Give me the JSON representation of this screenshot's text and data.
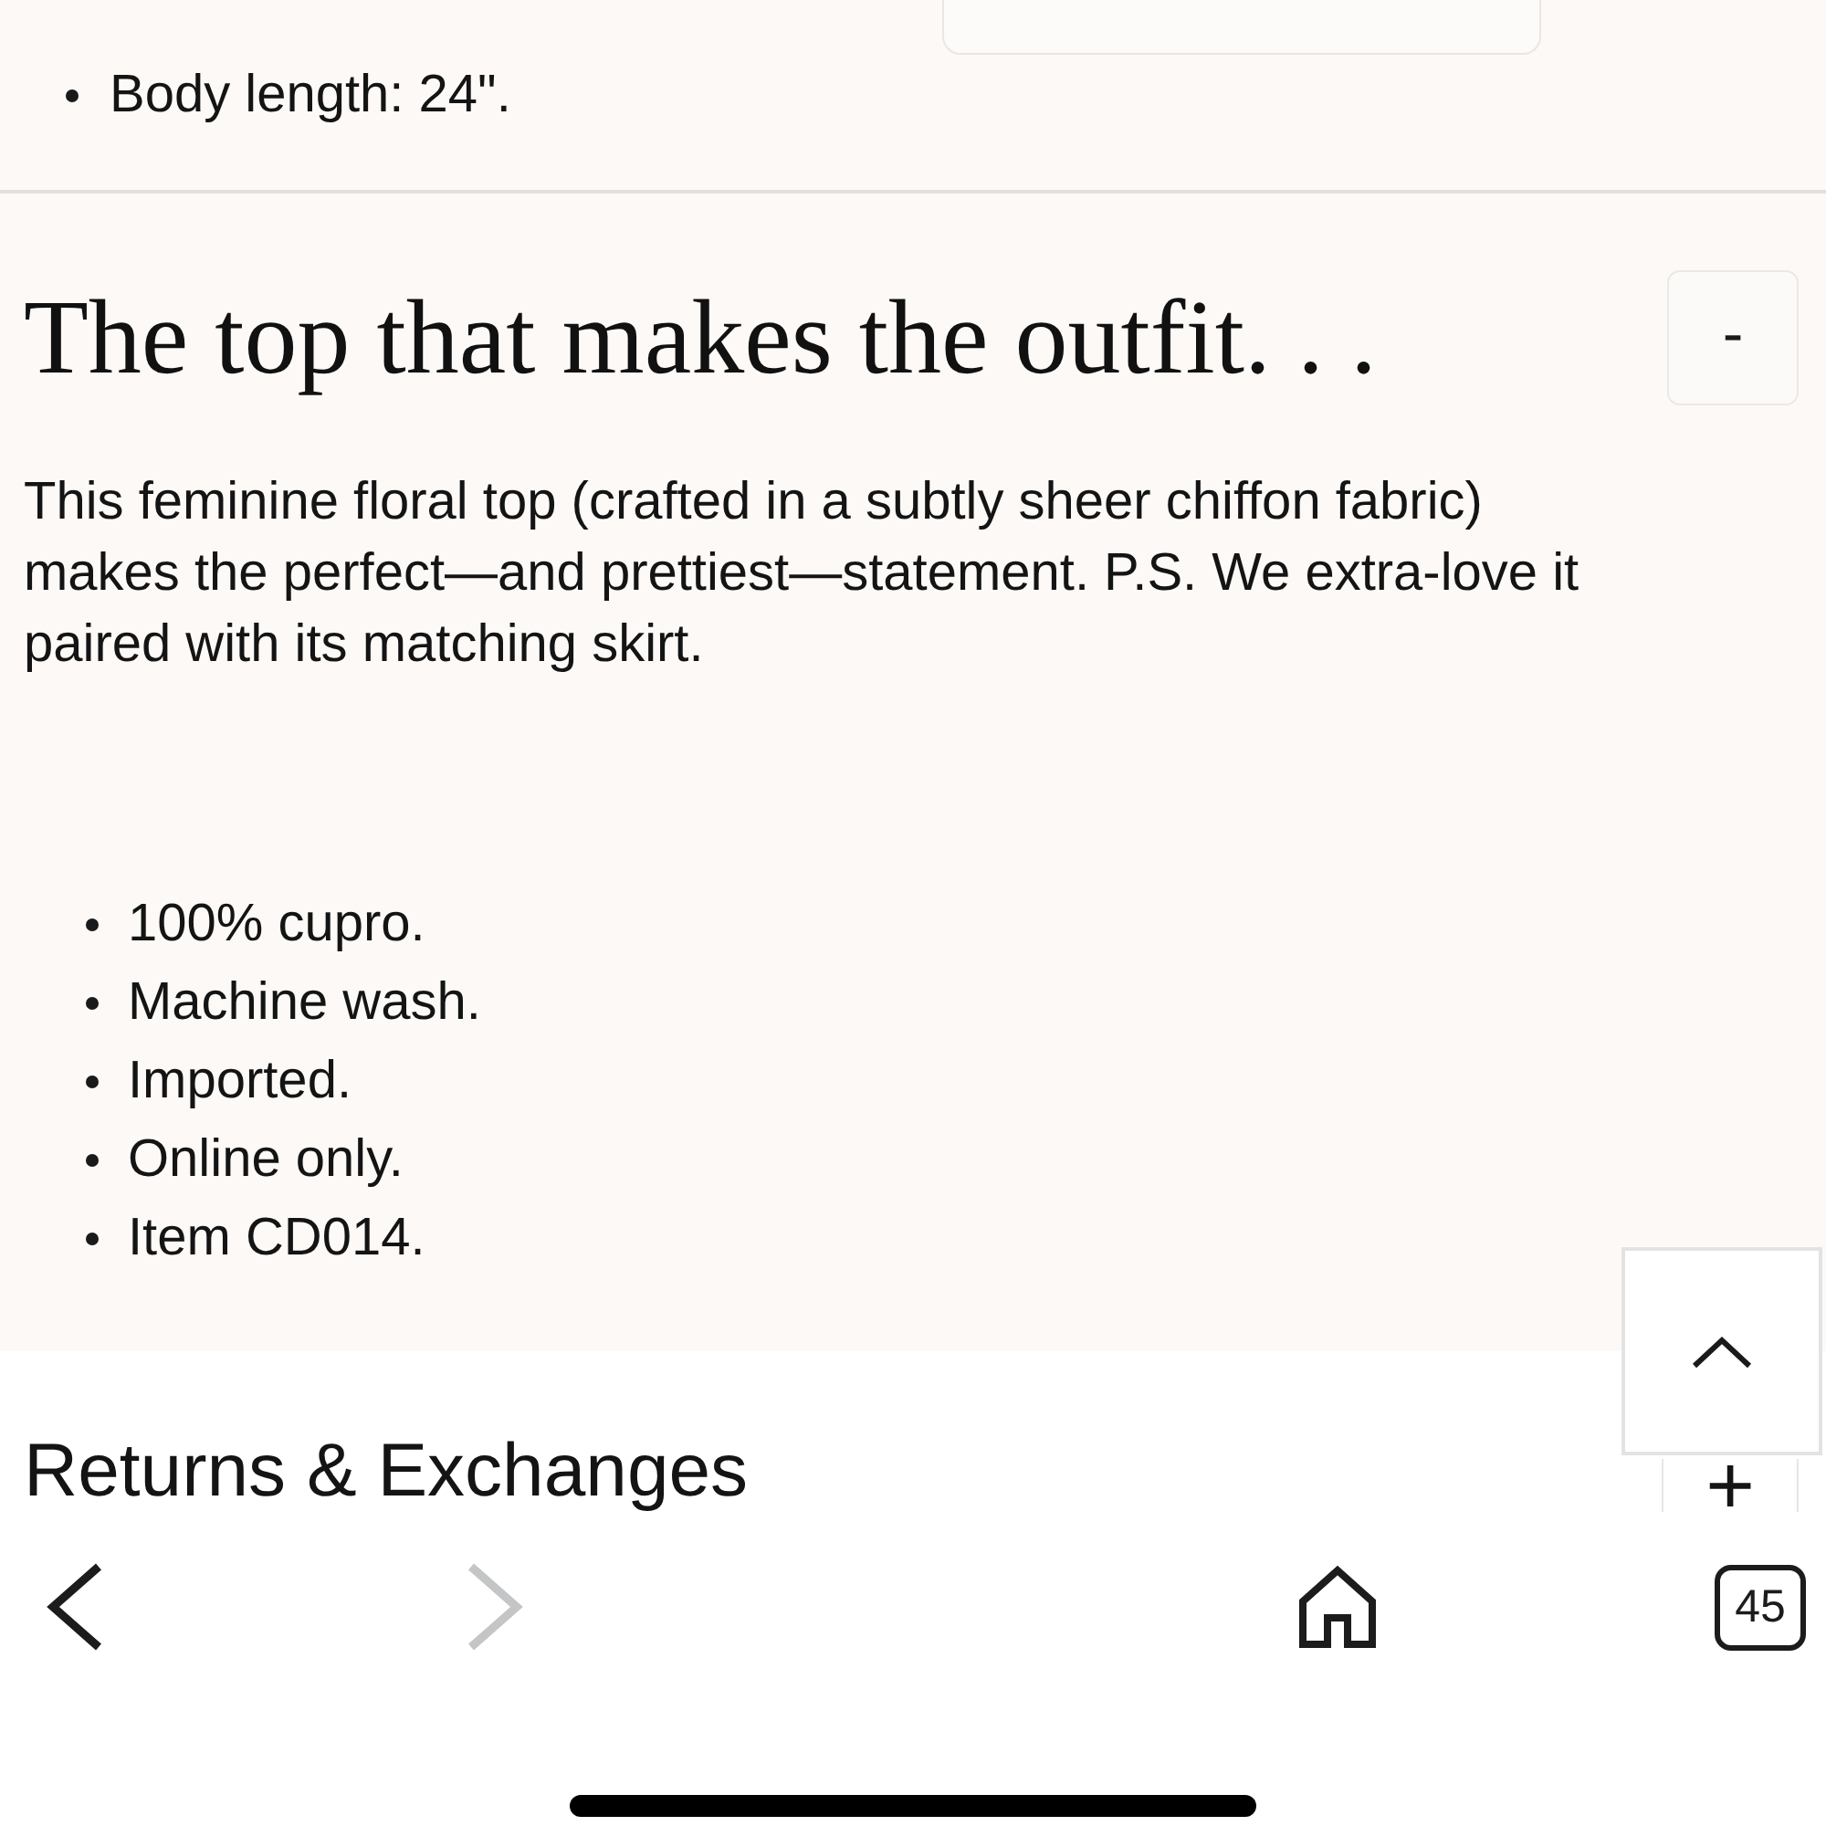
{
  "specs": [
    "Body length: 24\"."
  ],
  "description_section": {
    "title": "The top that makes the outfit. . .",
    "toggle": "-",
    "description": "This feminine floral top (crafted in a subtly sheer chiffon fabric) makes the perfect—and prettiest—statement. P.S. We extra-love it paired with its matching skirt.",
    "details": [
      "100% cupro.",
      "Machine wash.",
      "Imported.",
      "Online only.",
      "Item CD014."
    ]
  },
  "returns_section": {
    "title": "Returns & Exchanges",
    "toggle": "+"
  },
  "browser_toolbar": {
    "back": {
      "disabled": false
    },
    "forward": {
      "disabled": true
    },
    "tab_count": "45"
  }
}
